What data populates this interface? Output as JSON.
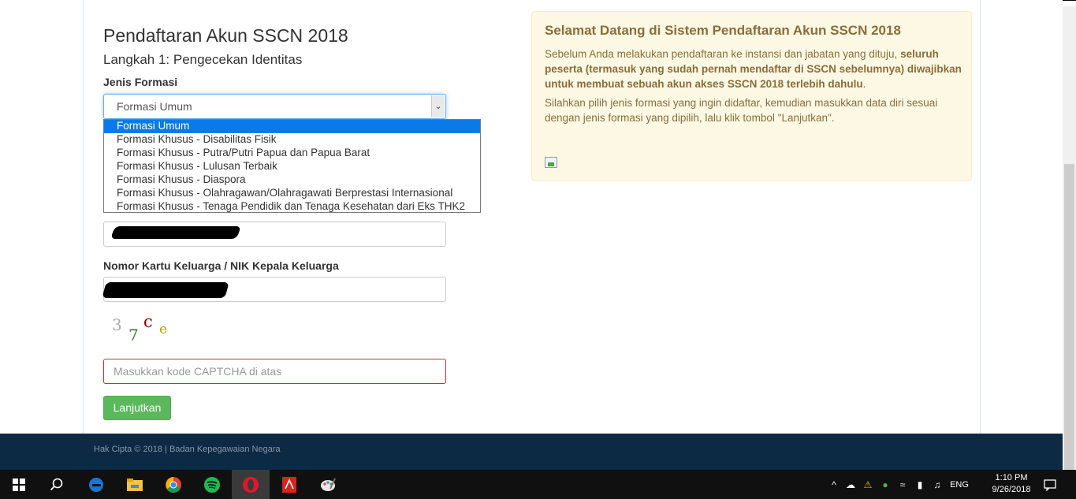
{
  "form": {
    "title": "Pendaftaran Akun SSCN 2018",
    "subtitle": "Langkah 1: Pengecekan Identitas",
    "jenis_formasi_label": "Jenis Formasi",
    "selected_formasi": "Formasi Umum",
    "formasi_options": [
      "Formasi Umum",
      "Formasi Khusus - Disabilitas Fisik",
      "Formasi Khusus -  Putra/Putri Papua dan Papua Barat",
      "Formasi Khusus - Lulusan Terbaik",
      "Formasi Khusus - Diaspora",
      "Formasi Khusus - Olahragawan/Olahragawati Berprestasi Internasional",
      "Formasi Khusus - Tenaga Pendidik dan Tenaga Kesehatan dari Eks THK2"
    ],
    "kk_label": "Nomor Kartu Keluarga / NIK Kepala Keluarga",
    "captcha_chars": [
      "3",
      "7",
      "c",
      "e"
    ],
    "captcha_placeholder": "Masukkan kode CAPTCHA di atas",
    "submit_label": "Lanjutkan"
  },
  "panel": {
    "title": "Selamat Datang di Sistem Pendaftaran Akun SSCN 2018",
    "para1_start": "Sebelum Anda melakukan pendaftaran ke instansi dan jabatan yang dituju, ",
    "para1_bold": "seluruh peserta (termasuk yang sudah pernah mendaftar di SSCN sebelumnya) diwajibkan untuk membuat sebuah akun akses SSCN 2018 terlebih dahulu",
    "para1_end": ".",
    "para2": "Silahkan pilih jenis formasi yang ingin didaftar, kemudian masukkan data diri sesuai dengan jenis formasi yang dipilih, lalu klik tombol \"Lanjutkan\"."
  },
  "footer": {
    "text": "Hak Cipta © 2018 | Badan Kepegawaian Negara"
  },
  "taskbar": {
    "language": "ENG",
    "time": "1:10 PM",
    "date": "9/26/2018"
  },
  "colors": {
    "accent_blue": "#0a7ae8",
    "success_green": "#5cb85c",
    "warning_panel": "#fcf8e3",
    "footer_navy": "#0d2a45"
  }
}
